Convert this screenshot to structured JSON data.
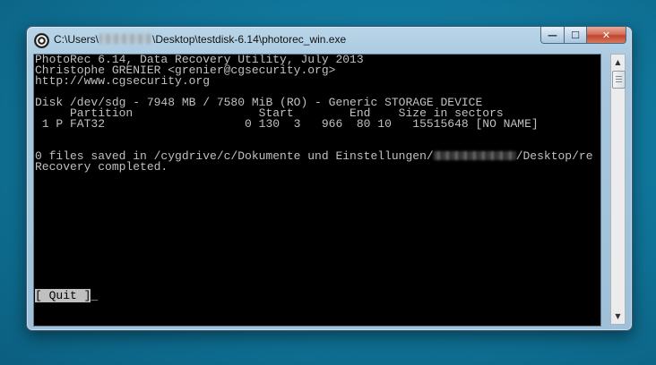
{
  "window": {
    "title_prefix": "C:\\Users\\",
    "title_suffix": "\\Desktop\\testdisk-6.14\\photorec_win.exe",
    "controls": {
      "minimize": "—",
      "maximize": "☐",
      "close": "✕"
    }
  },
  "console": {
    "header_line1": "PhotoRec 6.14, Data Recovery Utility, July 2013",
    "header_line2": "Christophe GRENIER <grenier@cgsecurity.org>",
    "header_line3": "http://www.cgsecurity.org",
    "disk_line": "Disk /dev/sdg - 7948 MB / 7580 MiB (RO) - Generic STORAGE DEVICE",
    "columns_line": "     Partition                  Start        End    Size in sectors",
    "partition_line": " 1 P FAT32                    0 130  3   966  80 10   15515648 [NO NAME]",
    "saved_prefix": "0 files saved in /cygdrive/c/Dokumente und Einstellungen/",
    "saved_suffix": "/Desktop/re",
    "status_line": "Recovery completed.",
    "quit_label": "[ Quit ]",
    "cursor": "_"
  },
  "scrollbar": {
    "up_arrow": "▲",
    "down_arrow": "▼"
  }
}
